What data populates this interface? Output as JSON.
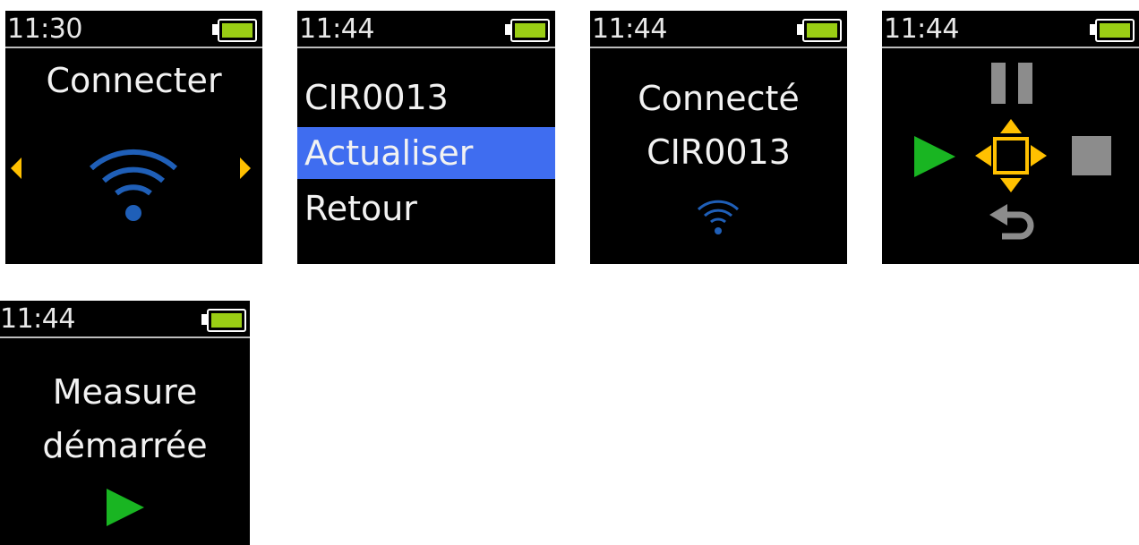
{
  "colors": {
    "screen_bg": "#000000",
    "battery_fill": "#9acd14",
    "wifi_blue": "#1f5fb8",
    "arrow_yellow": "#ffc000",
    "play_green": "#19b522",
    "control_gray": "#8c8c8c",
    "selection_blue": "#3f6df0"
  },
  "screens": [
    {
      "name": "connect",
      "time": "11:30",
      "title": "Connecter",
      "icons": [
        "arrow-left-icon",
        "wifi-icon",
        "arrow-right-icon"
      ]
    },
    {
      "name": "device-menu",
      "time": "11:44",
      "menu_items": [
        {
          "label": "CIR0013",
          "selected": false
        },
        {
          "label": "Actualiser",
          "selected": true
        },
        {
          "label": "Retour",
          "selected": false
        }
      ]
    },
    {
      "name": "connected",
      "time": "11:44",
      "line1": "Connecté",
      "line2": "CIR0013",
      "icons": [
        "wifi-icon"
      ]
    },
    {
      "name": "controls",
      "time": "11:44",
      "icons": [
        "pause-icon",
        "play-icon",
        "direction-pad-icon",
        "stop-icon",
        "back-arrow-icon"
      ]
    },
    {
      "name": "measure-started",
      "time": "11:44",
      "line1": "Measure",
      "line2": "démarrée",
      "icons": [
        "play-icon"
      ]
    }
  ]
}
